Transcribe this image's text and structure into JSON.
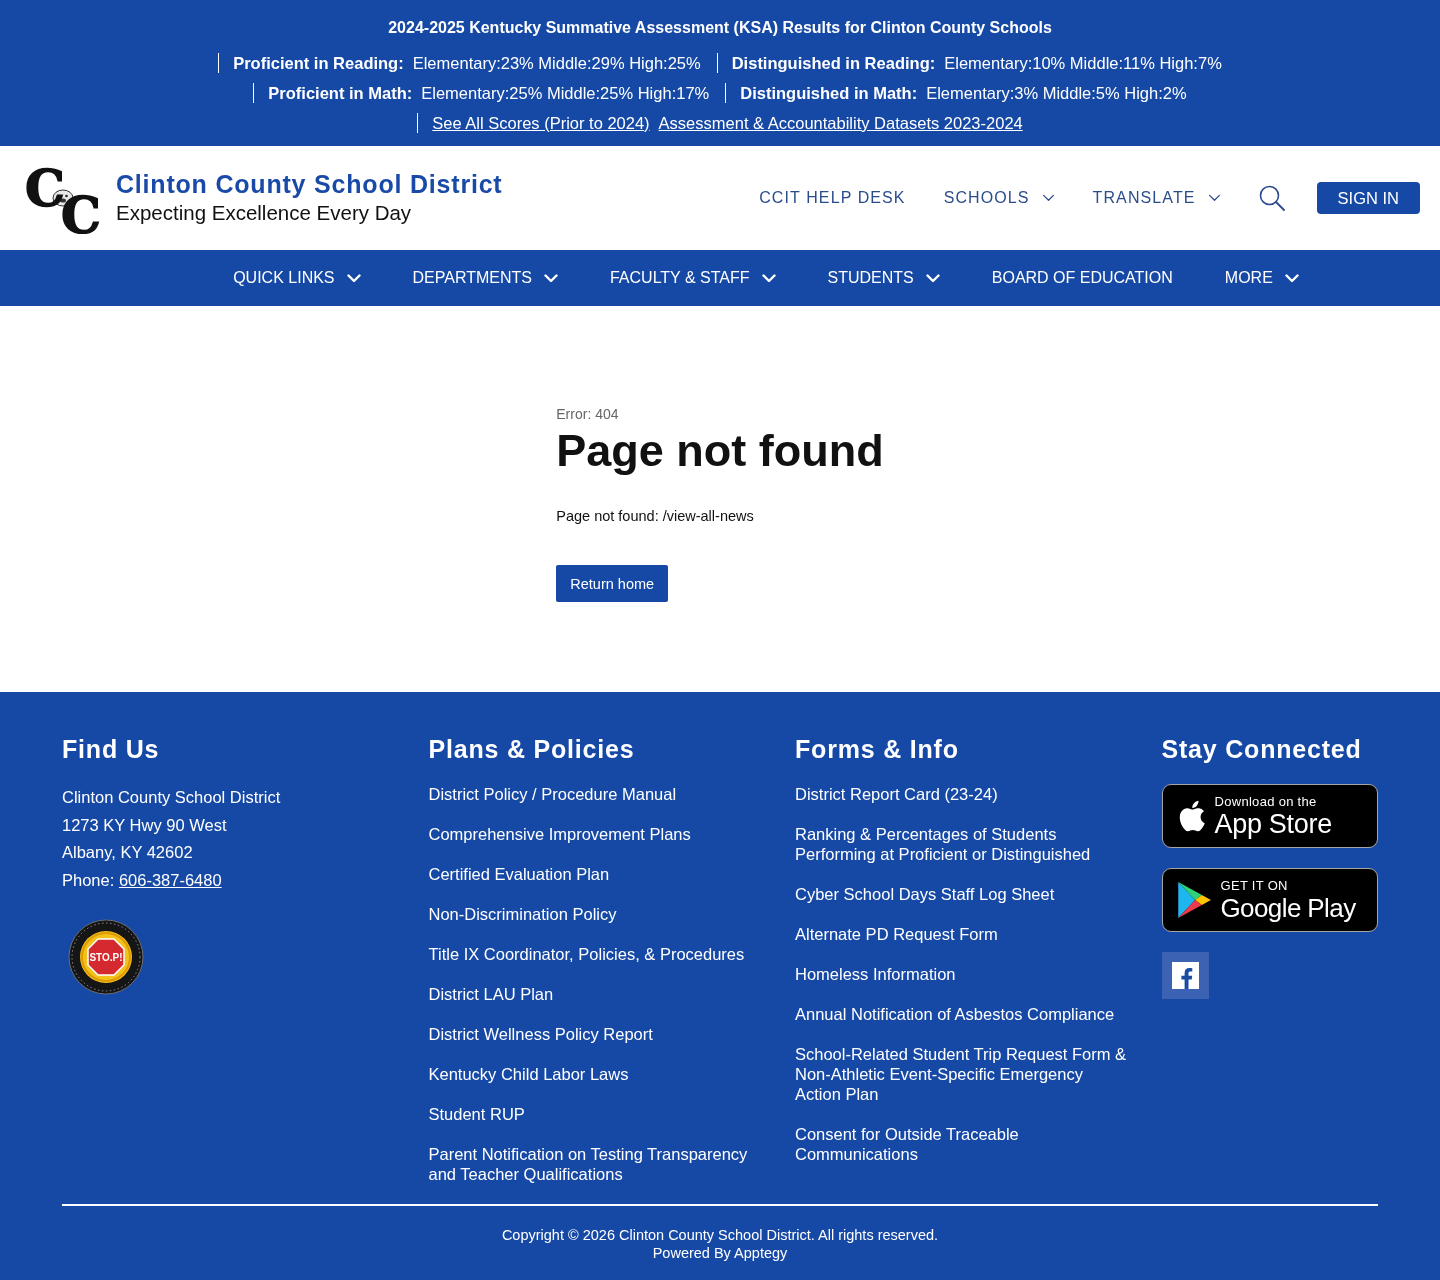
{
  "banner": {
    "title": "2024-2025 Kentucky Summative Assessment (KSA) Results for Clinton County Schools",
    "rows": [
      {
        "groups": [
          {
            "kind": "stat",
            "label": "Proficient in Reading:",
            "value": "Elementary:23% Middle:29% High:25%"
          },
          {
            "kind": "stat",
            "label": "Distinguished in Reading:",
            "value": "Elementary:10% Middle:11% High:7%"
          }
        ]
      },
      {
        "groups": [
          {
            "kind": "stat",
            "label": "Proficient in Math:",
            "value": "Elementary:25% Middle:25% High:17%"
          },
          {
            "kind": "stat",
            "label": "Distinguished in Math:",
            "value": "Elementary:3% Middle:5% High:2%"
          }
        ]
      },
      {
        "groups": [
          {
            "kind": "links",
            "links": [
              "See All Scores (Prior to 2024)",
              "Assessment & Accountability Datasets 2023-2024"
            ]
          }
        ]
      }
    ]
  },
  "header": {
    "logo_letters": "CC",
    "title": "Clinton County School District",
    "tagline": "Expecting Excellence Every Day",
    "links": [
      {
        "label": "CCIT HELP DESK",
        "dropdown": false
      },
      {
        "label": "SCHOOLS",
        "dropdown": true
      },
      {
        "label": "TRANSLATE",
        "dropdown": true
      }
    ],
    "sign_in": "SIGN IN"
  },
  "nav": {
    "items": [
      {
        "label": "QUICK LINKS",
        "dropdown": true
      },
      {
        "label": "DEPARTMENTS",
        "dropdown": true
      },
      {
        "label": "FACULTY & STAFF",
        "dropdown": true
      },
      {
        "label": "STUDENTS",
        "dropdown": true
      },
      {
        "label": "BOARD OF EDUCATION",
        "dropdown": false
      },
      {
        "label": "MORE",
        "dropdown": true
      }
    ]
  },
  "main": {
    "error_code": "Error: 404",
    "heading": "Page not found",
    "message": "Page not found: /view-all-news",
    "button": "Return home"
  },
  "footer": {
    "columns": [
      {
        "kind": "address",
        "heading": "Find Us",
        "lines": [
          "Clinton County School District",
          "1273 KY Hwy 90 West",
          "Albany, KY 42602"
        ],
        "phone_label": "Phone:",
        "phone": "606-387-6480",
        "badge_text": "STO.P!"
      },
      {
        "kind": "links",
        "heading": "Plans & Policies",
        "links": [
          "District Policy / Procedure Manual",
          "Comprehensive Improvement Plans",
          "Certified Evaluation Plan",
          "Non-Discrimination Policy",
          "Title IX Coordinator, Policies, & Procedures",
          "District LAU Plan",
          "District Wellness Policy Report",
          "Kentucky Child Labor Laws",
          "Student RUP",
          "Parent Notification on Testing Transparency and Teacher Qualifications"
        ]
      },
      {
        "kind": "links",
        "heading": "Forms & Info",
        "links": [
          "District Report Card (23-24)",
          "Ranking & Percentages of Students Performing at Proficient or Distinguished",
          "Cyber School Days Staff Log Sheet",
          "Alternate PD Request Form",
          "Homeless Information",
          "Annual Notification of Asbestos Compliance",
          "School-Related Student Trip Request Form & Non-Athletic Event-Specific Emergency Action Plan",
          "Consent for Outside Traceable Communications"
        ]
      },
      {
        "kind": "apps",
        "heading": "Stay Connected",
        "badges": [
          {
            "kind": "apple",
            "small": "Download on the",
            "large": "App Store"
          },
          {
            "kind": "google",
            "small": "GET IT ON",
            "large": "Google Play"
          }
        ],
        "social": [
          {
            "kind": "facebook"
          }
        ]
      }
    ],
    "copyright": "Copyright © 2026 Clinton County School District. All rights reserved.",
    "powered_by": "Powered By Apptegy"
  }
}
